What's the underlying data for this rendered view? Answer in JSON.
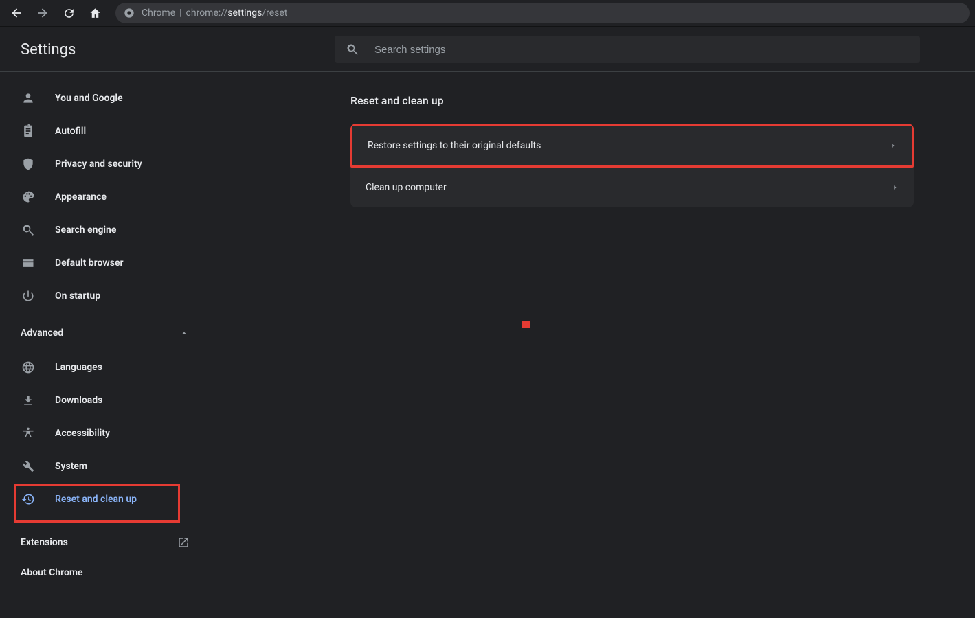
{
  "omnibox": {
    "prefix": "Chrome",
    "url_muted": "chrome://",
    "url_bold": "settings",
    "url_tail": "/reset"
  },
  "header": {
    "title": "Settings",
    "search_placeholder": "Search settings"
  },
  "sidebar": {
    "items": [
      {
        "label": "You and Google"
      },
      {
        "label": "Autofill"
      },
      {
        "label": "Privacy and security"
      },
      {
        "label": "Appearance"
      },
      {
        "label": "Search engine"
      },
      {
        "label": "Default browser"
      },
      {
        "label": "On startup"
      }
    ],
    "advanced_label": "Advanced",
    "advanced_items": [
      {
        "label": "Languages"
      },
      {
        "label": "Downloads"
      },
      {
        "label": "Accessibility"
      },
      {
        "label": "System"
      },
      {
        "label": "Reset and clean up"
      }
    ],
    "extensions": "Extensions",
    "about": "About Chrome"
  },
  "main": {
    "section_title": "Reset and clean up",
    "rows": [
      {
        "label": "Restore settings to their original defaults"
      },
      {
        "label": "Clean up computer"
      }
    ]
  }
}
